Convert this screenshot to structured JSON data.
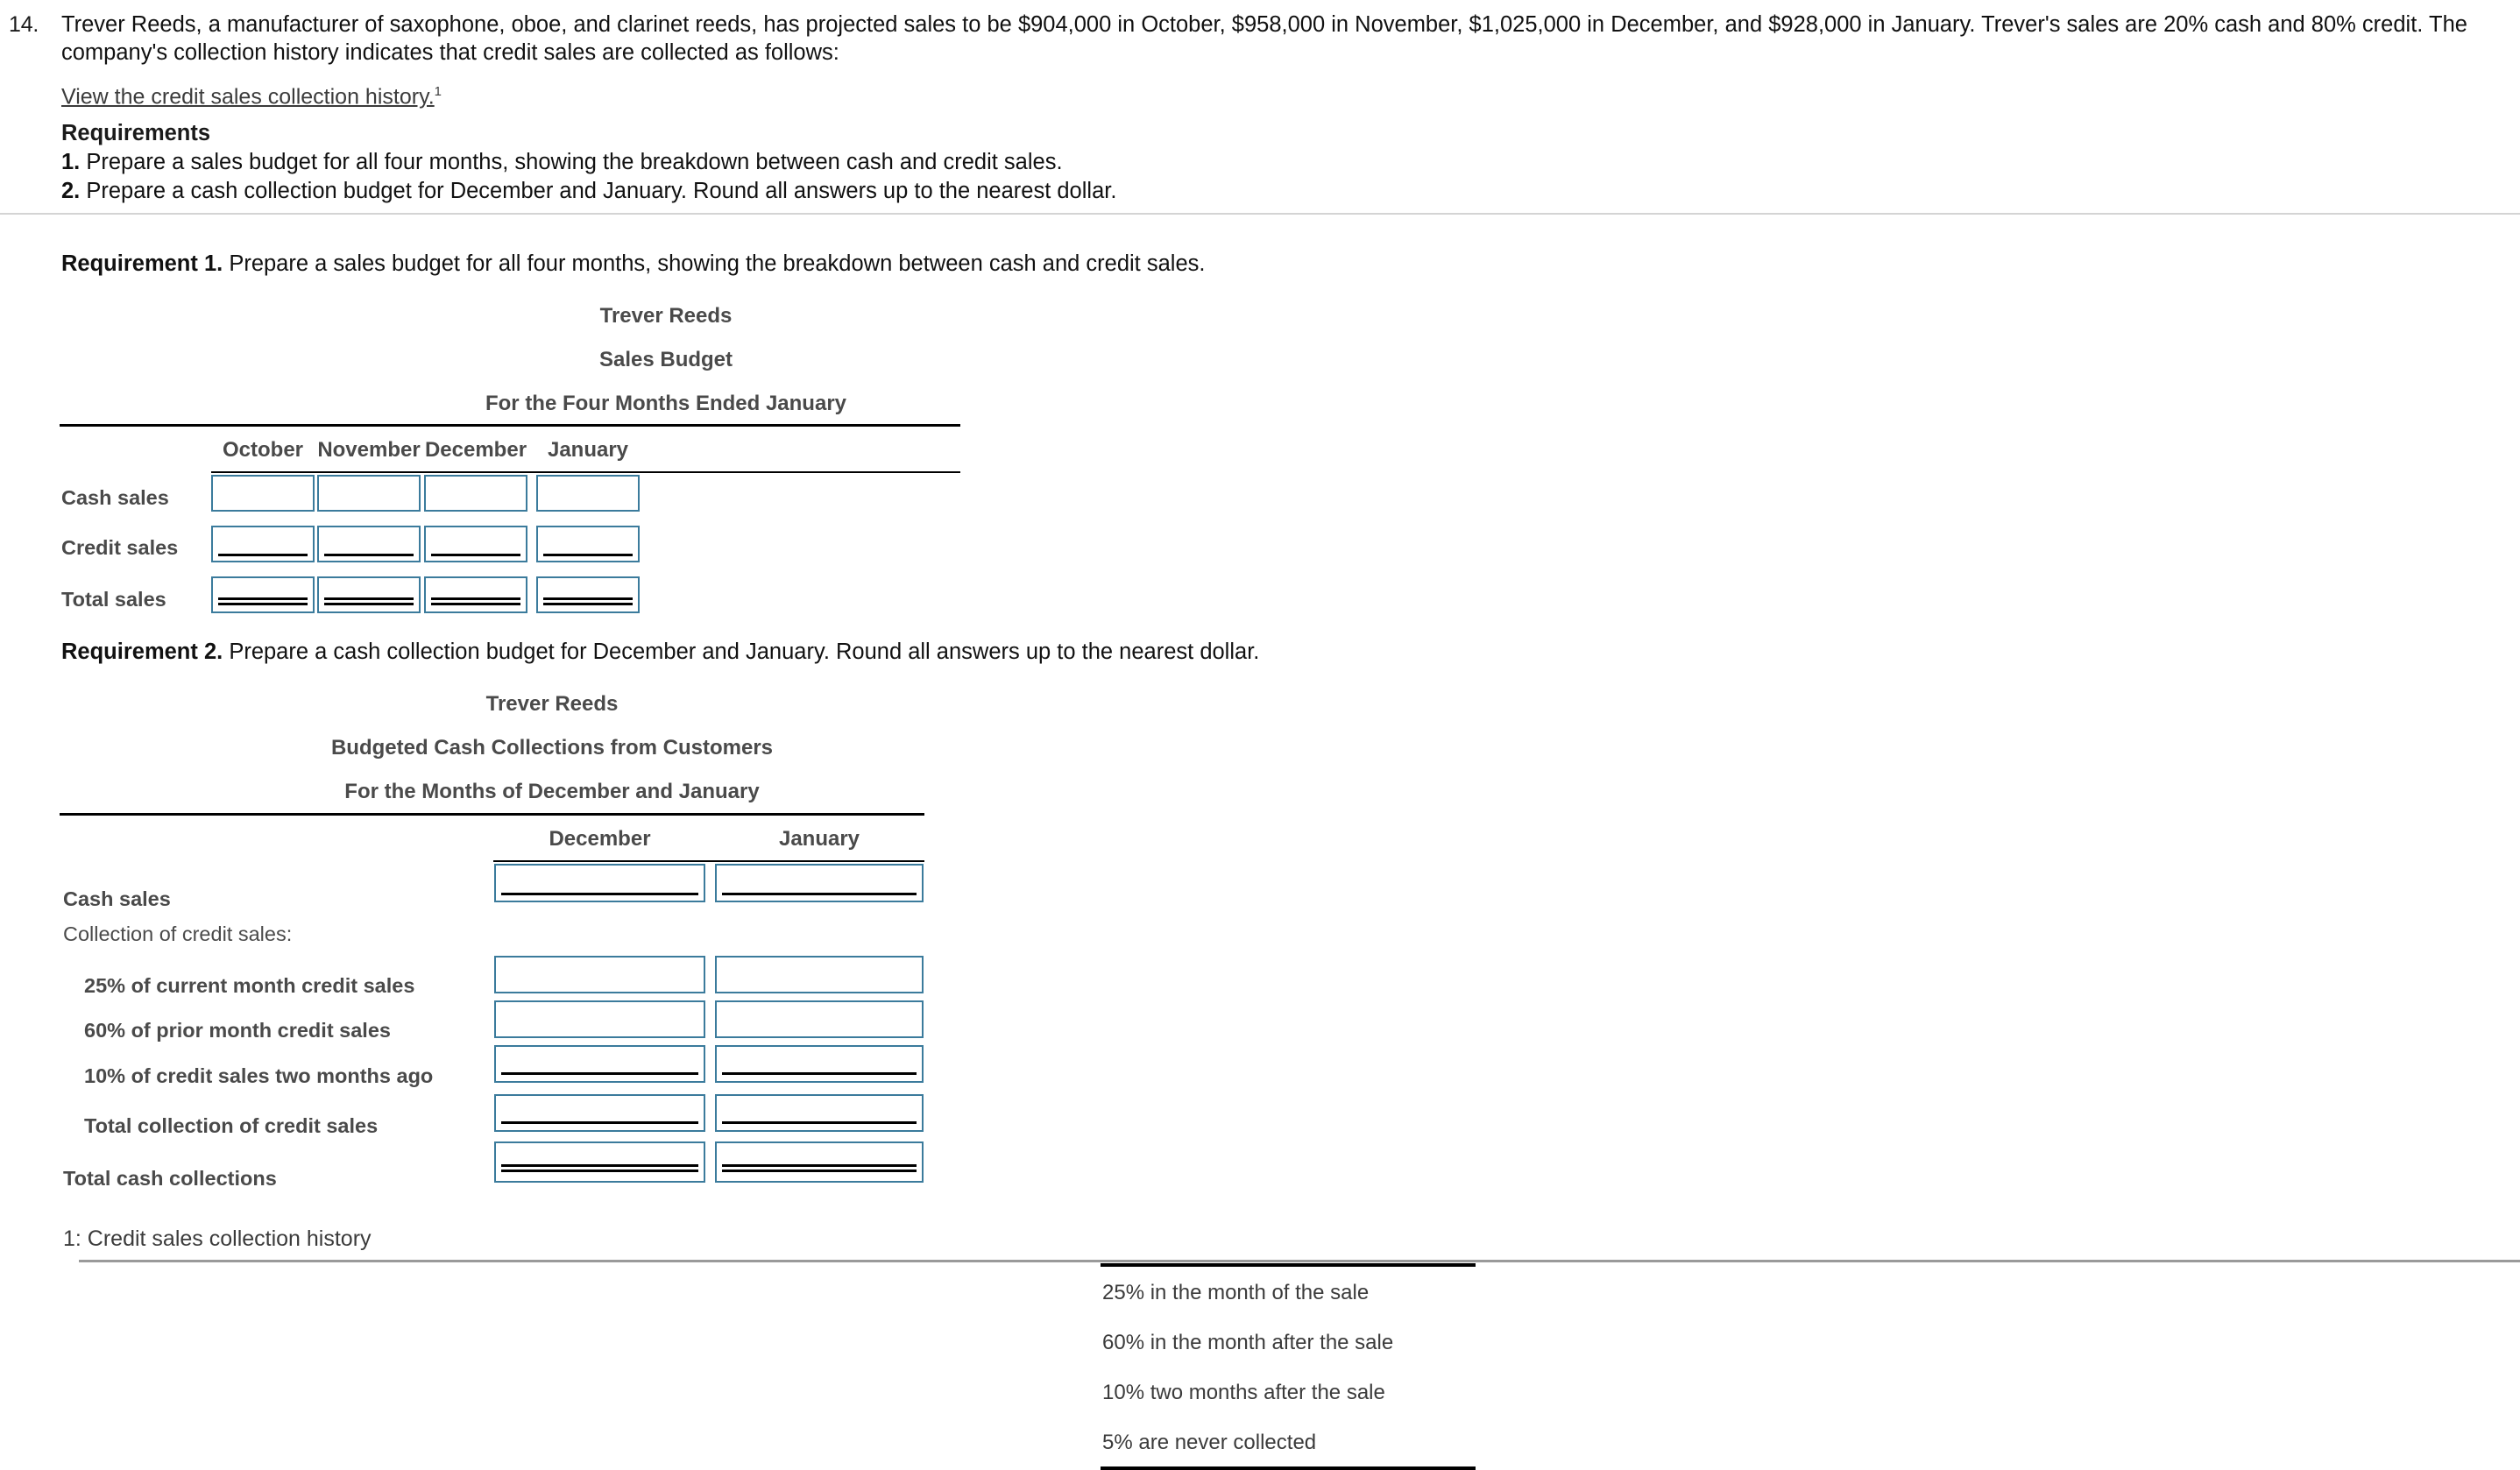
{
  "problem": {
    "number": "14.",
    "paragraph": "Trever Reeds, a manufacturer of saxophone, oboe, and clarinet reeds, has projected sales to be $904,000 in October, $958,000 in November, $1,025,000 in December, and $928,000 in January. Trever's sales are 20% cash and 80% credit. The company's collection history indicates that credit sales are collected as follows:",
    "link_text": "View the credit sales collection history.",
    "link_superscript": "1",
    "requirements_title": "Requirements",
    "requirement_1_number": "1.",
    "requirement_1_text": "Prepare a sales budget for all four months, showing the breakdown between cash and credit sales.",
    "requirement_2_number": "2.",
    "requirement_2_text": "Prepare a cash collection budget for December and January. Round all answers up to the nearest dollar."
  },
  "requirement1": {
    "heading_label": "Requirement 1.",
    "heading_text": "Prepare a sales budget for all four months, showing the breakdown between cash and credit sales.",
    "statement": {
      "company": "Trever Reeds",
      "title": "Sales Budget",
      "period": "For the Four Months Ended January",
      "columns": [
        "October",
        "November",
        "December",
        "January"
      ],
      "rows": [
        {
          "label": "Cash sales",
          "values": [
            "",
            "",
            "",
            ""
          ],
          "rule": "none"
        },
        {
          "label": "Credit sales",
          "values": [
            "",
            "",
            "",
            ""
          ],
          "rule": "single"
        },
        {
          "label": "Total sales",
          "values": [
            "",
            "",
            "",
            ""
          ],
          "rule": "double"
        }
      ]
    }
  },
  "requirement2": {
    "heading_label": "Requirement 2.",
    "heading_text": "Prepare a cash collection budget for December and January. Round all answers up to the nearest dollar.",
    "statement": {
      "company": "Trever Reeds",
      "title": "Budgeted Cash Collections from Customers",
      "period": "For the Months of December and January",
      "columns": [
        "December",
        "January"
      ],
      "rows": [
        {
          "label": "Cash sales",
          "values": [
            "",
            ""
          ],
          "rule": "single",
          "indent": 0,
          "bold": true,
          "has_inputs": true
        },
        {
          "label": "Collection of credit sales:",
          "values": [],
          "rule": "none",
          "indent": 0,
          "bold": false,
          "has_inputs": false
        },
        {
          "label": "25% of current month credit sales",
          "values": [
            "",
            ""
          ],
          "rule": "none",
          "indent": 1,
          "bold": true,
          "has_inputs": true
        },
        {
          "label": "60% of prior month credit sales",
          "values": [
            "",
            ""
          ],
          "rule": "none",
          "indent": 1,
          "bold": true,
          "has_inputs": true
        },
        {
          "label": "10% of credit sales two months ago",
          "values": [
            "",
            ""
          ],
          "rule": "single",
          "indent": 1,
          "bold": true,
          "has_inputs": true
        },
        {
          "label": "Total collection of credit sales",
          "values": [
            "",
            ""
          ],
          "rule": "single",
          "indent": 1,
          "bold": true,
          "has_inputs": true
        },
        {
          "label": "Total cash collections",
          "values": [
            "",
            ""
          ],
          "rule": "double",
          "indent": 0,
          "bold": true,
          "has_inputs": true
        }
      ]
    }
  },
  "footnote": {
    "title": "1: Credit sales collection history",
    "items": [
      "25% in the month of the sale",
      "60% in the month after the sale",
      "10% two months after the sale",
      "5% are never collected"
    ]
  },
  "input_placeholder": ""
}
